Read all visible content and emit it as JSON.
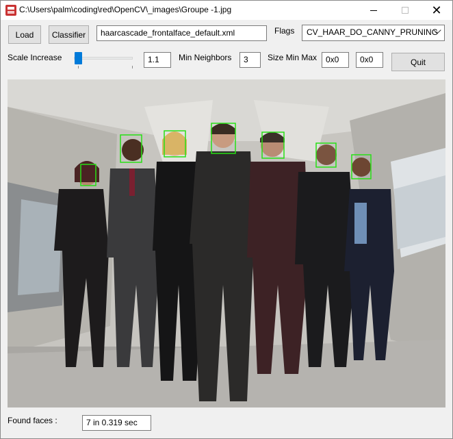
{
  "window": {
    "title": "C:\\Users\\palm\\coding\\red\\OpenCV\\_images\\Groupe -1.jpg",
    "close_glyph": "✕"
  },
  "toolbar": {
    "load_label": "Load",
    "classifier_label": "Classifier",
    "classifier_file": "haarcascade_frontalface_default.xml",
    "flags_label": "Flags",
    "flags_value": "CV_HAAR_DO_CANNY_PRUNING",
    "scale_label": "Scale Increase",
    "scale_value": "1.1",
    "min_neighbors_label": "Min Neighbors",
    "min_neighbors_value": "3",
    "size_label": "Size Min Max",
    "size_min": "0x0",
    "size_max": "0x0",
    "quit_label": "Quit"
  },
  "status": {
    "found_label": "Found faces :",
    "found_value": "7 in 0.319 sec"
  },
  "colors": {
    "face_box": "#27e014",
    "slider_thumb": "#007ad9"
  }
}
